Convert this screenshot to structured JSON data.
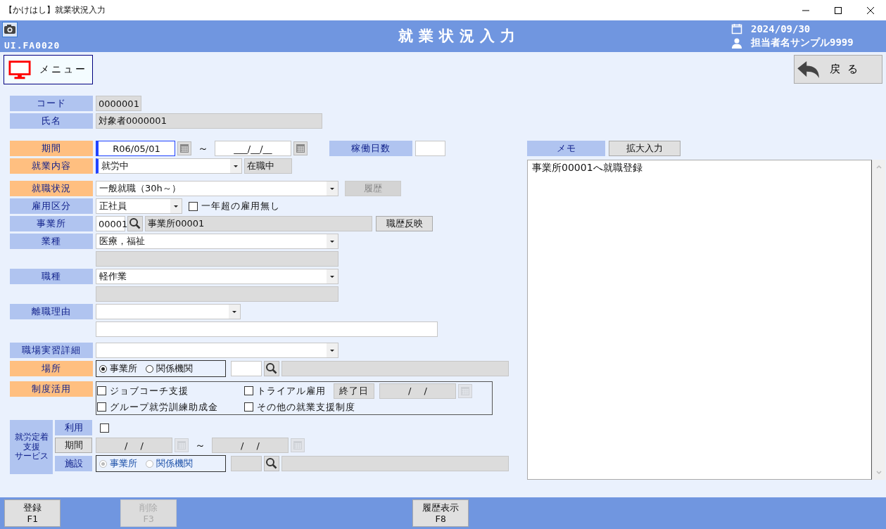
{
  "window": {
    "title": "【かけはし】就業状況入力"
  },
  "header": {
    "screen_id": "UI.FA0020",
    "title": "就業状況入力",
    "date": "2024/09/30",
    "user": "担当者名サンプル9999"
  },
  "menu_button": "メニュー",
  "back_button": "戻る",
  "form": {
    "code": {
      "label": "コード",
      "required": false,
      "value": "0000001"
    },
    "name": {
      "label": "氏名",
      "required": false,
      "value": "対象者0000001"
    },
    "period": {
      "label": "期間",
      "required": true,
      "from": "R06/05/01",
      "separator": "～",
      "to": "___/__/__"
    },
    "work_days": {
      "label": "稼働日数",
      "required": false
    },
    "work_content": {
      "label": "就業内容",
      "required": true,
      "value": "就労中",
      "status": "在職中"
    },
    "employment_status": {
      "label": "就職状況",
      "required": true,
      "value": "一般就職（30h～）",
      "button": {
        "label": "履歴",
        "disabled": true
      }
    },
    "employment_type": {
      "label": "雇用区分",
      "required": false,
      "value": "正社員",
      "checkbox": {
        "label": "一年超の雇用無し",
        "checked": false
      }
    },
    "office": {
      "label": "事業所",
      "required": false,
      "code": "00001",
      "name": "事業所00001",
      "button": {
        "label": "職歴反映",
        "disabled": false
      }
    },
    "industry": {
      "label": "業種",
      "required": false,
      "value": "医療，福祉"
    },
    "occupation": {
      "label": "職種",
      "required": false,
      "value": "軽作業"
    },
    "leave_reason": {
      "label": "離職理由",
      "required": false
    },
    "internship": {
      "label": "職場実習詳細",
      "required": false
    },
    "place": {
      "label": "場所",
      "required": true,
      "options": [
        {
          "label": "事業所",
          "selected": true
        },
        {
          "label": "関係機関",
          "selected": false
        }
      ]
    },
    "programs": {
      "label": "制度活用",
      "required": true,
      "options": [
        {
          "label": "ジョブコーチ支援",
          "checked": false
        },
        {
          "label": "トライアル雇用",
          "checked": false
        },
        {
          "label": "グループ就労訓練助成金",
          "checked": false
        },
        {
          "label": "その他の就業支援制度",
          "checked": false
        }
      ],
      "end_date": {
        "label": "終了日",
        "value": "/ /"
      }
    },
    "retention": {
      "label_lines": [
        "就労定着",
        "支援",
        "サービス"
      ],
      "use": {
        "label": "利用",
        "checked": false
      },
      "period": {
        "label": "期間",
        "from": "/ /",
        "separator": "～",
        "to": "/ /",
        "disabled": true
      },
      "facility": {
        "label": "施設",
        "disabled": true,
        "options": [
          {
            "label": "事業所",
            "selected": true
          },
          {
            "label": "関係機関",
            "selected": false
          }
        ]
      }
    }
  },
  "memo": {
    "label": "メモ",
    "expand_button": "拡大入力",
    "text": "事業所00001へ就職登録"
  },
  "footer_buttons": [
    {
      "label": "登録",
      "key": "F1",
      "disabled": false
    },
    {
      "label": "削除",
      "key": "F3",
      "disabled": true
    },
    {
      "label": "履歴表示",
      "key": "F8",
      "disabled": false
    }
  ]
}
